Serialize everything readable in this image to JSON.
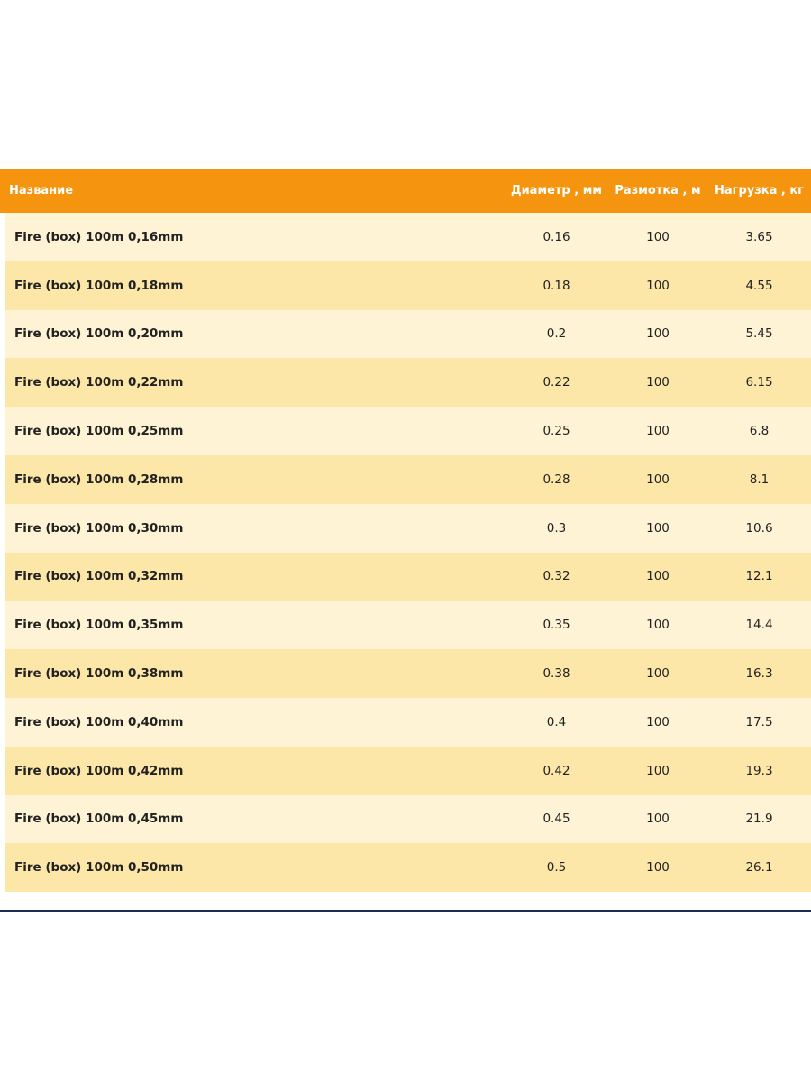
{
  "table": {
    "headers": {
      "name": "Название",
      "diameter": "Диаметр , мм",
      "spool": "Размотка , м",
      "load": "Нагрузка , кг"
    },
    "rows": [
      {
        "name": "Fire (box) 100m 0,16mm",
        "diameter": "0.16",
        "spool": "100",
        "load": "3.65"
      },
      {
        "name": "Fire (box) 100m 0,18mm",
        "diameter": "0.18",
        "spool": "100",
        "load": "4.55"
      },
      {
        "name": "Fire (box) 100m 0,20mm",
        "diameter": "0.2",
        "spool": "100",
        "load": "5.45"
      },
      {
        "name": "Fire (box) 100m 0,22mm",
        "diameter": "0.22",
        "spool": "100",
        "load": "6.15"
      },
      {
        "name": "Fire (box) 100m 0,25mm",
        "diameter": "0.25",
        "spool": "100",
        "load": "6.8"
      },
      {
        "name": "Fire (box) 100m 0,28mm",
        "diameter": "0.28",
        "spool": "100",
        "load": "8.1"
      },
      {
        "name": "Fire (box) 100m 0,30mm",
        "diameter": "0.3",
        "spool": "100",
        "load": "10.6"
      },
      {
        "name": "Fire (box) 100m 0,32mm",
        "diameter": "0.32",
        "spool": "100",
        "load": "12.1"
      },
      {
        "name": "Fire (box) 100m 0,35mm",
        "diameter": "0.35",
        "spool": "100",
        "load": "14.4"
      },
      {
        "name": "Fire (box) 100m 0,38mm",
        "diameter": "0.38",
        "spool": "100",
        "load": "16.3"
      },
      {
        "name": "Fire (box) 100m 0,40mm",
        "diameter": "0.4",
        "spool": "100",
        "load": "17.5"
      },
      {
        "name": "Fire (box) 100m 0,42mm",
        "diameter": "0.42",
        "spool": "100",
        "load": "19.3"
      },
      {
        "name": "Fire (box) 100m 0,45mm",
        "diameter": "0.45",
        "spool": "100",
        "load": "21.9"
      },
      {
        "name": "Fire (box) 100m 0,50mm",
        "diameter": "0.5",
        "spool": "100",
        "load": "26.1"
      }
    ]
  },
  "colors": {
    "header_bg": "#f5950f",
    "row_light": "#fef4d5",
    "row_dark": "#fde7a8",
    "rule": "#1e2a55"
  }
}
